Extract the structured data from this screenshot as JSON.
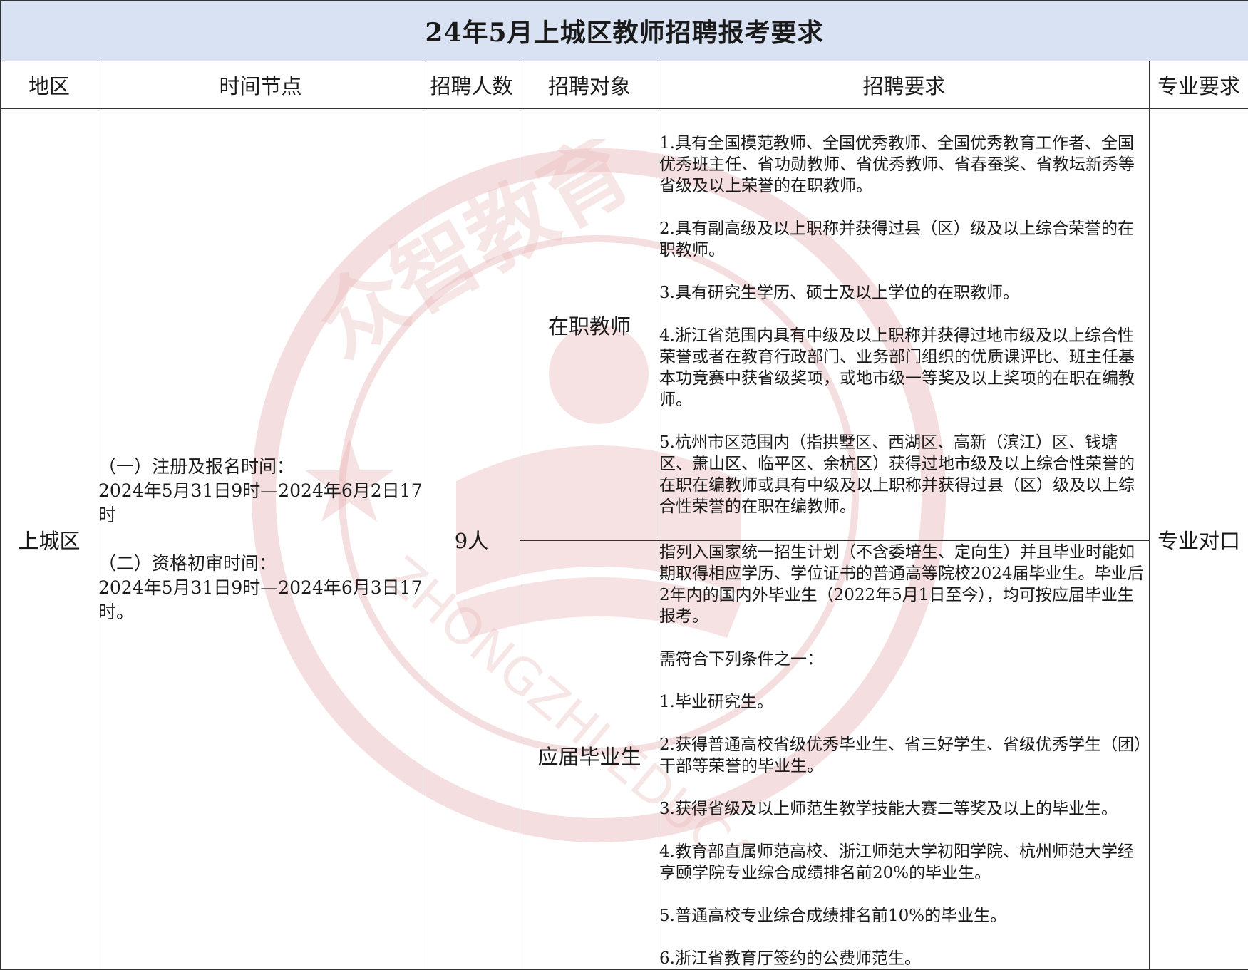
{
  "title": "24年5月上城区教师招聘报考要求",
  "headers": {
    "region": "地区",
    "timeline": "时间节点",
    "count": "招聘人数",
    "target": "招聘对象",
    "requirements": "招聘要求",
    "major": "专业要求"
  },
  "row": {
    "region": "上城区",
    "timeline": {
      "item1_label": "（一）注册及报名时间：",
      "item1_value": "2024年5月31日9时—2024年6月2日17时",
      "item2_label": "（二）资格初审时间：",
      "item2_value": "2024年5月31日9时—2024年6月3日17时。"
    },
    "count": "9人",
    "major": "专业对口",
    "targets": [
      {
        "name": "在职教师",
        "requirements": [
          "1.具有全国模范教师、全国优秀教师、全国优秀教育工作者、全国优秀班主任、省功勋教师、省优秀教师、省春蚕奖、省教坛新秀等省级及以上荣誉的在职教师。",
          "2.具有副高级及以上职称并获得过县（区）级及以上综合荣誉的在职教师。",
          "3.具有研究生学历、硕士及以上学位的在职教师。",
          "4.浙江省范围内具有中级及以上职称并获得过地市级及以上综合性荣誉或者在教育行政部门、业务部门组织的优质课评比、班主任基本功竞赛中获省级奖项，或地市级一等奖及以上奖项的在职在编教师。",
          "5.杭州市区范围内（指拱墅区、西湖区、高新（滨江）区、钱塘区、萧山区、临平区、余杭区）获得过地市级及以上综合性荣誉的在职在编教师或具有中级及以上职称并获得过县（区）级及以上综合性荣誉的在职在编教师。"
        ]
      },
      {
        "name": "应届毕业生",
        "intro": "指列入国家统一招生计划（不含委培生、定向生）并且毕业时能如期取得相应学历、学位证书的普通高等院校2024届毕业生。毕业后2年内的国内外毕业生（2022年5月1日至今），均可按应届毕业生报考。",
        "lead": "需符合下列条件之一：",
        "requirements": [
          "1.毕业研究生。",
          "2.获得普通高校省级优秀毕业生、省三好学生、省级优秀学生（团）干部等荣誉的毕业生。",
          "3.获得省级及以上师范生教学技能大赛二等奖及以上的毕业生。",
          "4.教育部直属师范高校、浙江师范大学初阳学院、杭州师范大学经亨颐学院专业综合成绩排名前20%的毕业生。",
          "5.普通高校专业综合成绩排名前10%的毕业生。",
          "6.浙江省教育厅签约的公费师范生。"
        ]
      }
    ]
  },
  "colors": {
    "title_background": "#d9e2f3",
    "border": "#333333",
    "watermark": "#e8b6b8"
  },
  "watermark": {
    "chars": "众智教育",
    "latin": "ZHONGZHI EDUCATION"
  }
}
